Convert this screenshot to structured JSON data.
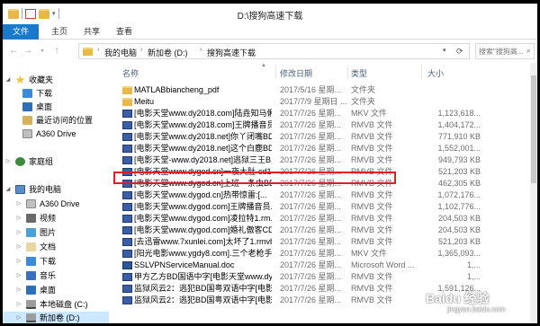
{
  "window": {
    "title": "D:\\搜狗高速下载"
  },
  "ribbon": {
    "tabs": [
      "文件",
      "主页",
      "共享",
      "查看"
    ]
  },
  "address": {
    "segments": [
      "我的电脑",
      "新加卷 (D:)",
      "搜狗高速下载"
    ],
    "search_placeholder": "搜索\"搜狗高..."
  },
  "nav": {
    "favorites": "收藏夹",
    "items_fav": [
      "下载",
      "桌面",
      "最近访问的位置",
      "A360 Drive"
    ],
    "homegroup": "家庭组",
    "pc": "我的电脑",
    "items_pc": [
      "A360 Drive",
      "视频",
      "图片",
      "文档",
      "下载",
      "音乐",
      "桌面",
      "本地磁盘 (C:)",
      "新加卷 (D:)"
    ]
  },
  "columns": {
    "name": "名称",
    "date": "修改日期",
    "type": "类型",
    "size": "大小"
  },
  "files": [
    {
      "name": "MATLABbiancheng_pdf",
      "date": "2017/5/16 星期...",
      "type": "文件夹",
      "size": "",
      "icon": "folder"
    },
    {
      "name": "Meitu",
      "date": "2017/7/9 星期日 ...",
      "type": "文件夹",
      "size": "",
      "icon": "folder"
    },
    {
      "name": "[电影天堂www.dy2018.com]陆垚知马俐...",
      "date": "2017/7/26 星期...",
      "type": "MKV 文件",
      "size": "1,123,618...",
      "icon": "video"
    },
    {
      "name": "[电影天堂www.dy2018.com]王牌播音员...",
      "date": "2017/7/26 星期...",
      "type": "RMVB 文件",
      "size": "1,404,172...",
      "icon": "video"
    },
    {
      "name": "[电影天堂www.dy2018.net]你丫闭嘴BD...",
      "date": "2017/7/26 星期...",
      "type": "RMVB 文件",
      "size": "771,910 KB",
      "icon": "video"
    },
    {
      "name": "[电影天堂www.dy2018.net]这个白鹿BD...",
      "date": "2017/7/26 星期...",
      "type": "RMVB 文件",
      "size": "1,552,001...",
      "icon": "video"
    },
    {
      "name": "[电影天堂-www.dy2018.net]逃狱三王B...",
      "date": "2017/7/26 星期...",
      "type": "RMVB 文件",
      "size": "949,793 KB",
      "icon": "video"
    },
    {
      "name": "[电影天堂www.dygod.cn]一夜大肚-cd1...",
      "date": "2017/7/26 星期...",
      "type": "RMVB 文件",
      "size": "521,203 KB",
      "icon": "video"
    },
    {
      "name": "[电影天堂www.dygod.cn]上班一条虫BD...",
      "date": "2017/7/26 星期...",
      "type": "RMVB 文件",
      "size": "462,305 KB",
      "icon": "video"
    },
    {
      "name": "[电影天堂www.dygod.cn]热带惊雷:[...",
      "date": "2017/7/26 星期...",
      "type": "RMVB 文件",
      "size": "1,072,176...",
      "icon": "video"
    },
    {
      "name": "[电影天堂www.dygod.com]王牌播音员...",
      "date": "2017/7/26 星期...",
      "type": "RMVB 文件",
      "size": "1,102,776...",
      "icon": "video"
    },
    {
      "name": "[电影天堂www.dygod.com]凌拉特1.rm...",
      "date": "2017/7/26 星期...",
      "type": "RMVB 文件",
      "size": "204,503 KB",
      "icon": "video"
    },
    {
      "name": "[电影天堂www.dygod.com]婚礼傲客CD...",
      "date": "2017/7/26 星期...",
      "type": "RMVB 文件",
      "size": "204,503 KB",
      "icon": "video"
    },
    {
      "name": "[去迅雷www.7xunlei.com]太坏了1.rmvb",
      "date": "2017/7/26 星期...",
      "type": "RMVB 文件",
      "size": "521,203 KB",
      "icon": "video"
    },
    {
      "name": "[阳光电影www.ygdy8.com].三个老枪手...",
      "date": "2017/7/26 星期...",
      "type": "MKV 文件",
      "size": "1,365,093...",
      "icon": "video"
    },
    {
      "name": "SSLVPNServiceManual.doc",
      "date": "2017/7/26 星期...",
      "type": "Microsoft Word ...",
      "size": "1,...",
      "icon": "word"
    },
    {
      "name": "甲方乙方BD国语中字[电影天堂www.dy2...",
      "date": "2017/7/26 星期...",
      "type": "RMVB 文件",
      "size": "1,...",
      "icon": "video"
    },
    {
      "name": "监狱风云2：逃犯BD国粤双语中字[电影...",
      "date": "2017/7/26 星期...",
      "type": "RMVB 文件",
      "size": "1,591,126...",
      "icon": "video"
    },
    {
      "name": "监狱风云2：逃犯BD国粤双语中字[电影...",
      "date": "2017/7/26 星期...",
      "type": "RMVB 文件",
      "size": "",
      "icon": "video"
    }
  ],
  "watermark": {
    "line1": "Baidu 经验",
    "line2": "jingyan.baidu.com"
  },
  "colors": {
    "accent": "#1979ca",
    "selection": "#cce8ff",
    "highlight_box": "#e02020"
  }
}
